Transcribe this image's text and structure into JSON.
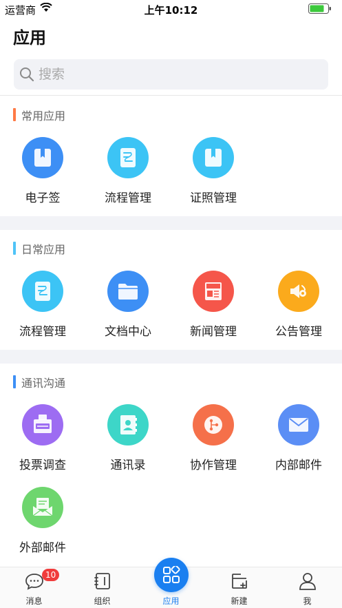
{
  "status_bar": {
    "carrier": "运营商",
    "time": "上午10:12"
  },
  "page": {
    "title": "应用"
  },
  "search": {
    "placeholder": "搜索"
  },
  "sections": [
    {
      "title": "常用应用",
      "accent_color": "#ff7a45",
      "apps": [
        {
          "label": "电子签",
          "icon": "bookmark-folder-icon",
          "color": "#3d8ff5"
        },
        {
          "label": "流程管理",
          "icon": "workflow-document-icon",
          "color": "#3cc4f5"
        },
        {
          "label": "证照管理",
          "icon": "bookmark-folder-icon",
          "color": "#3cc4f5"
        }
      ]
    },
    {
      "title": "日常应用",
      "accent_color": "#4fc3f7",
      "apps": [
        {
          "label": "流程管理",
          "icon": "workflow-document-icon",
          "color": "#3cc4f5"
        },
        {
          "label": "文档中心",
          "icon": "folder-icon",
          "color": "#3d8ff5"
        },
        {
          "label": "新闻管理",
          "icon": "news-icon",
          "color": "#f5564a"
        },
        {
          "label": "公告管理",
          "icon": "announcement-icon",
          "color": "#fbaa1c"
        }
      ]
    },
    {
      "title": "通讯沟通",
      "accent_color": "#3d8ff5",
      "apps": [
        {
          "label": "投票调查",
          "icon": "vote-box-icon",
          "color": "#9d6cf2"
        },
        {
          "label": "通讯录",
          "icon": "address-book-icon",
          "color": "#3dd6c8"
        },
        {
          "label": "协作管理",
          "icon": "collaboration-icon",
          "color": "#f5704a"
        },
        {
          "label": "内部邮件",
          "icon": "mail-icon",
          "color": "#5b8ef5"
        },
        {
          "label": "外部邮件",
          "icon": "open-mail-icon",
          "color": "#6ed66e"
        }
      ]
    }
  ],
  "tab_bar": {
    "tabs": [
      {
        "label": "消息",
        "icon": "chat-bubble-icon",
        "badge": "10"
      },
      {
        "label": "组织",
        "icon": "notebook-icon"
      },
      {
        "label": "应用",
        "icon": "apps-grid-icon",
        "active": true
      },
      {
        "label": "新建",
        "icon": "new-document-icon"
      },
      {
        "label": "我",
        "icon": "person-icon"
      }
    ],
    "active_color": "#1a7ff0"
  }
}
